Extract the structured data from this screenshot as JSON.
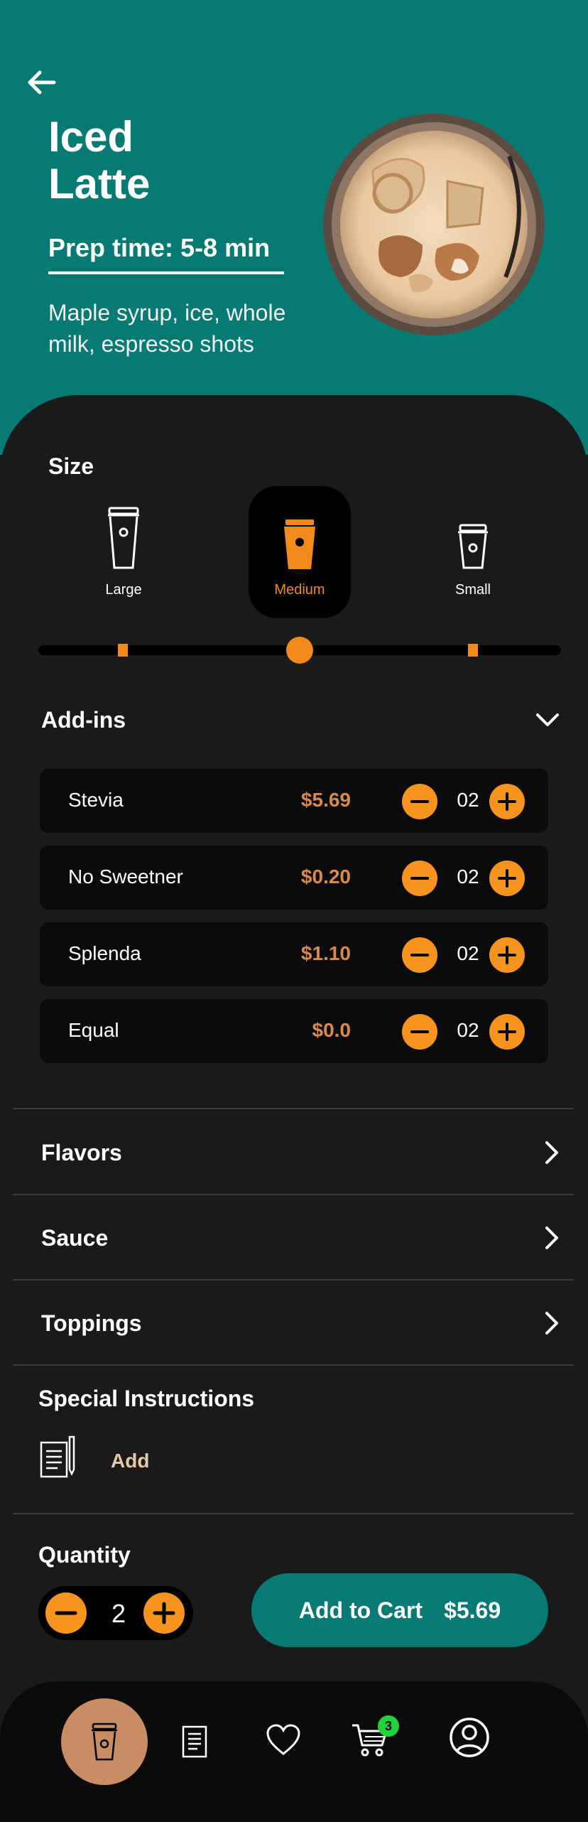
{
  "product": {
    "title": "Iced\nLatte",
    "prep_time": "Prep time: 5-8  min",
    "description": "Maple syrup, ice, whole milk, espresso shots"
  },
  "colors": {
    "header_bg": "#077a74",
    "accent_orange": "#f7941d",
    "price": "#d98a4a",
    "panel_bg": "#1a1a1a",
    "badge_green": "#22d33a"
  },
  "size": {
    "label": "Size",
    "options": [
      {
        "label": "Large",
        "selected": false
      },
      {
        "label": "Medium",
        "selected": true
      },
      {
        "label": "Small",
        "selected": false
      }
    ]
  },
  "addins": {
    "label": "Add-ins",
    "items": [
      {
        "name": "Stevia",
        "price": "$5.69",
        "qty": "02"
      },
      {
        "name": "No Sweetner",
        "price": "$0.20",
        "qty": "02"
      },
      {
        "name": "Splenda",
        "price": "$1.10",
        "qty": "02"
      },
      {
        "name": "Equal",
        "price": "$0.0",
        "qty": "02"
      }
    ]
  },
  "sections": {
    "flavors": "Flavors",
    "sauce": "Sauce",
    "toppings": "Toppings"
  },
  "special": {
    "title": "Special Instructions",
    "add_label": "Add"
  },
  "quantity": {
    "title": "Quantity",
    "value": "2"
  },
  "cart_button": {
    "label": "Add to Cart",
    "price": "$5.69"
  },
  "tabbar": {
    "items": [
      "coffee-cup-icon",
      "receipt-icon",
      "heart-icon",
      "cart-icon",
      "profile-icon"
    ],
    "cart_badge": "3"
  }
}
